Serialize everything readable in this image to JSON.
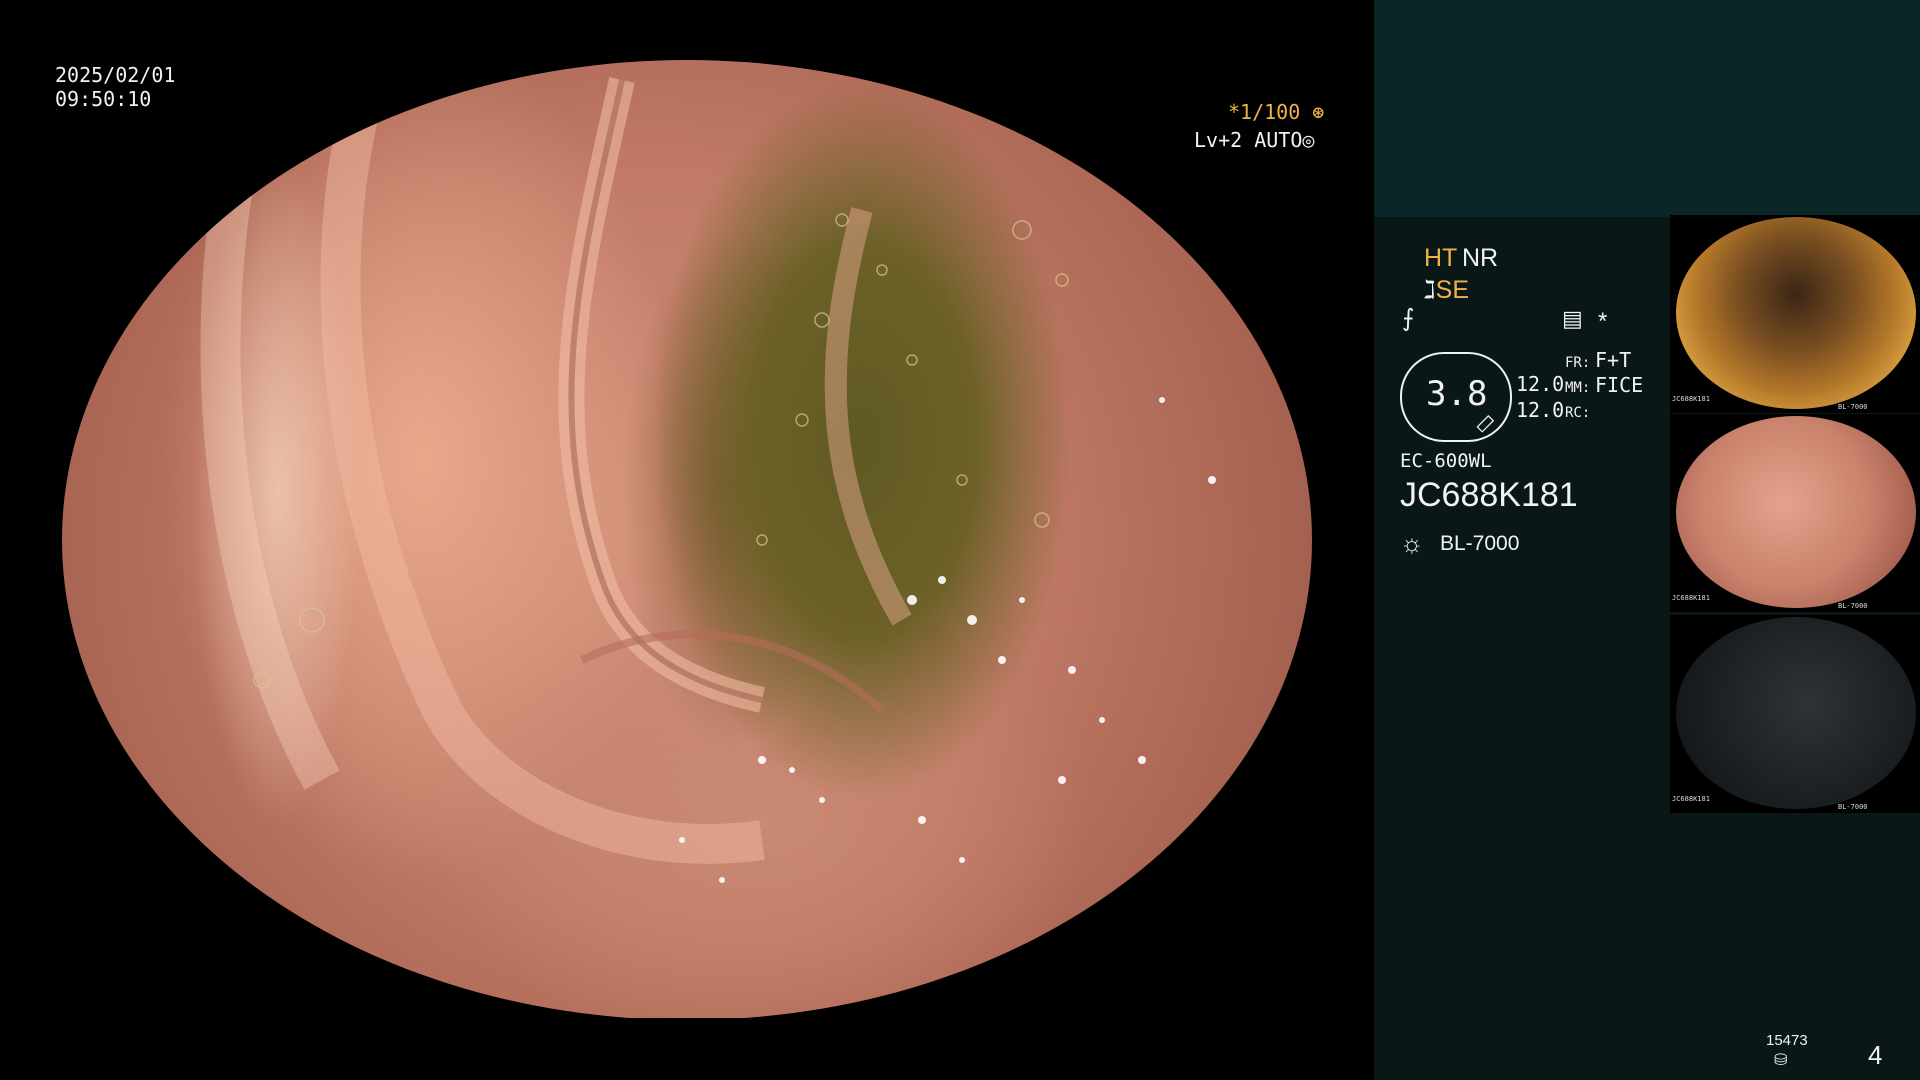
{
  "scope": {
    "date": "2025/02/01",
    "time": "09:50:10",
    "shutter": "*1/100",
    "level": "Lv+2 AUTO"
  },
  "panel": {
    "ht": "HT",
    "nr": "NR",
    "se": "SE",
    "asterisk": "*",
    "zoom": "3.8",
    "value1": "12.0",
    "value2": "12.0",
    "fr_label": "FR:",
    "fr_value": "F+T",
    "mm_label": "MM:",
    "mm_value": "FICE",
    "rc_label": "RC:",
    "model": "EC-600WL",
    "serial": "JC688K181",
    "light_source": "BL-7000",
    "image_count": "15473",
    "page_number": "4"
  },
  "thumbnails": [
    {
      "id": 1,
      "caption": "JC688K181",
      "source": "BL-7000"
    },
    {
      "id": 2,
      "caption": "JC688K181",
      "source": "BL-7000"
    },
    {
      "id": 3,
      "caption": "JC688K181",
      "source": "BL-7000"
    }
  ],
  "colors": {
    "accent_orange": "#f0b248",
    "panel_bg": "#0a1717",
    "panel_top_bg": "#0b2626",
    "tissue": "#c07a66"
  }
}
